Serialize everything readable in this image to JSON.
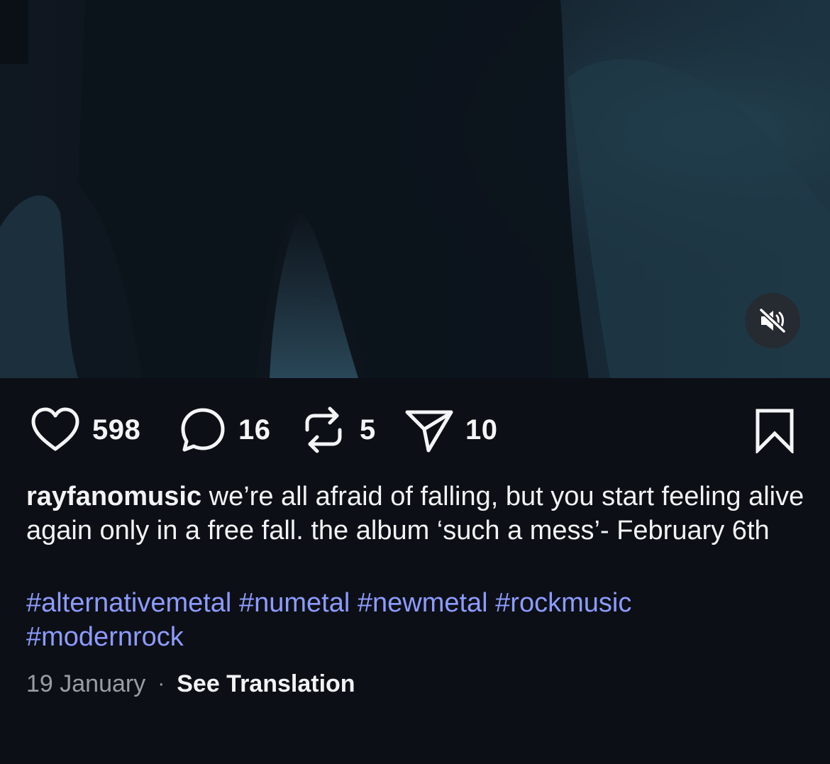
{
  "post": {
    "username": "rayfanomusic",
    "caption": "we’re all afraid of falling, but you start feeling alive again only in a free fall. the album ‘such a mess’- February 6th",
    "hashtags": [
      "#alternativemetal",
      "#numetal",
      "#newmetal",
      "#rockmusic",
      "#modernrock"
    ],
    "date": "19 January",
    "separator": "·",
    "see_translation": "See Translation"
  },
  "media": {
    "type": "video",
    "mute_icon": "speaker-muted-icon"
  },
  "actions": {
    "likes": {
      "icon": "heart-icon",
      "count": "598"
    },
    "comments": {
      "icon": "comment-bubble-icon",
      "count": "16"
    },
    "reposts": {
      "icon": "repost-icon",
      "count": "5"
    },
    "shares": {
      "icon": "send-icon",
      "count": "10"
    },
    "save": {
      "icon": "bookmark-icon"
    }
  },
  "colors": {
    "background": "#0c0f15",
    "text": "#f2f3f5",
    "hashtag": "#8e9bff",
    "muted_text": "#9a9da4"
  }
}
